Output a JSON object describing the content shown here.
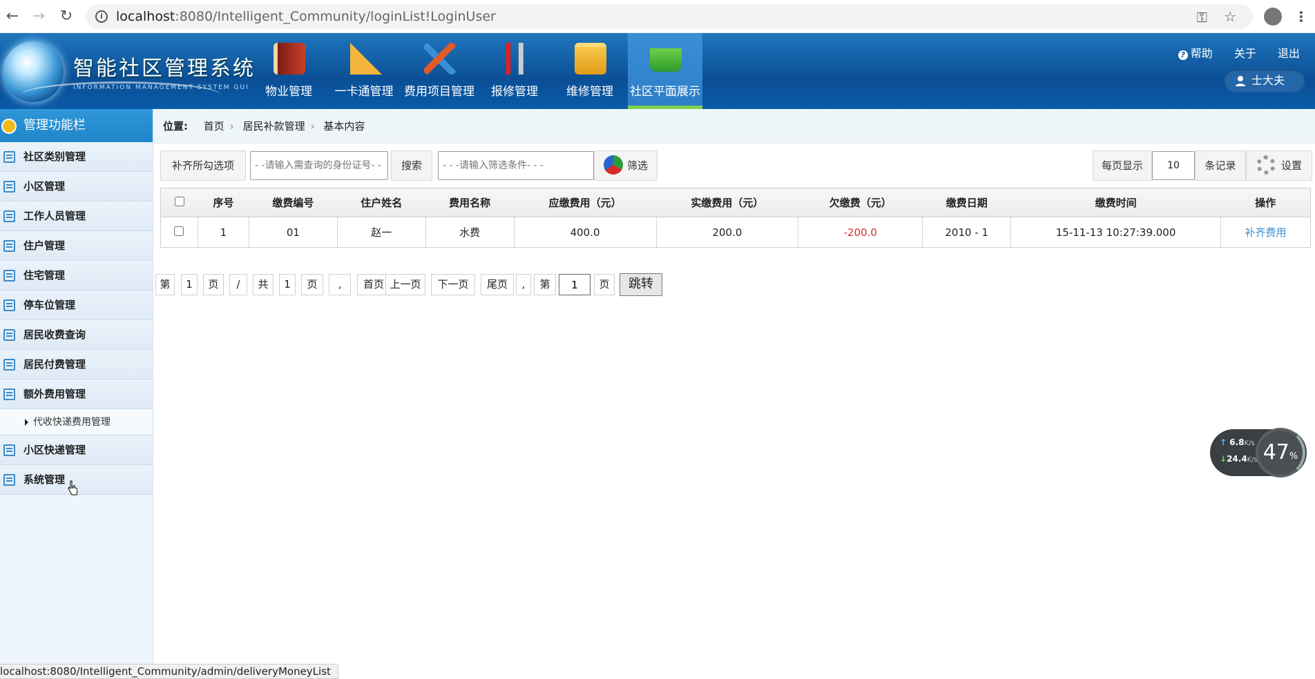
{
  "browser": {
    "url_host": "localhost",
    "url_rest": ":8080/Intelligent_Community/loginList!LoginUser",
    "status_url": "localhost:8080/Intelligent_Community/admin/deliveryMoneyList"
  },
  "header": {
    "logo_title": "智能社区管理系统",
    "logo_sub": "INFORMATION MANAGEMENT SYSTEM GUI",
    "modules": [
      {
        "label": "物业管理",
        "icon": "book-icon"
      },
      {
        "label": "一卡通管理",
        "icon": "ruler-icon"
      },
      {
        "label": "费用项目管理",
        "icon": "drafting-tools-icon"
      },
      {
        "label": "报修管理",
        "icon": "tools-icon"
      },
      {
        "label": "维修管理",
        "icon": "folder-download-icon"
      },
      {
        "label": "社区平面展示",
        "icon": "basket-icon",
        "active": true
      }
    ],
    "links": {
      "help": "帮助",
      "about": "关于",
      "logout": "退出"
    },
    "user": "士大夫"
  },
  "sidebar": {
    "title": "管理功能栏",
    "items": [
      {
        "label": "社区类别管理"
      },
      {
        "label": "小区管理"
      },
      {
        "label": "工作人员管理"
      },
      {
        "label": "住户管理"
      },
      {
        "label": "住宅管理"
      },
      {
        "label": "停车位管理"
      },
      {
        "label": "居民收费查询"
      },
      {
        "label": "居民付费管理"
      },
      {
        "label": "额外费用管理"
      },
      {
        "label": "小区快递管理"
      },
      {
        "label": "系统管理"
      }
    ],
    "sub_item": "代收快递费用管理"
  },
  "breadcrumb": {
    "label": "位置:",
    "items": [
      "首页",
      "居民补款管理",
      "基本内容"
    ]
  },
  "toolbar": {
    "fill_selected": "补齐所勾选项",
    "id_placeholder": "- -请输入需查询的身份证号- -",
    "search": "搜索",
    "filter_placeholder": "- - -请输入筛选条件- - -",
    "filter": "筛选",
    "per_page_label": "每页显示",
    "per_page_value": "10",
    "records_label": "条记录",
    "settings": "设置"
  },
  "table": {
    "columns": [
      "序号",
      "缴费编号",
      "住户姓名",
      "费用名称",
      "应缴费用（元）",
      "实缴费用（元）",
      "欠缴费（元）",
      "缴费日期",
      "缴费时间",
      "操作"
    ],
    "rows": [
      {
        "no": "1",
        "code": "01",
        "name": "赵一",
        "fee": "水费",
        "due": "400.0",
        "paid": "200.0",
        "owed": "-200.0",
        "date": "2010 - 1",
        "time": "15-11-13 10:27:39.000",
        "action": "补齐费用"
      }
    ]
  },
  "pager": {
    "di": "第",
    "current": "1",
    "ye": "页",
    "slash": "/",
    "gong": "共",
    "total": "1",
    "ye2": "页",
    "comma": ",",
    "first": "首页",
    "prev": "上一页",
    "next": "下一页",
    "last": "尾页",
    "comma2": ",",
    "di2": "第",
    "input": "1",
    "ye3": "页",
    "jump": "跳转"
  },
  "net_widget": {
    "up": "6.8",
    "down": "24.4",
    "unit": "K/s",
    "percent": "47",
    "percent_sign": "%"
  }
}
